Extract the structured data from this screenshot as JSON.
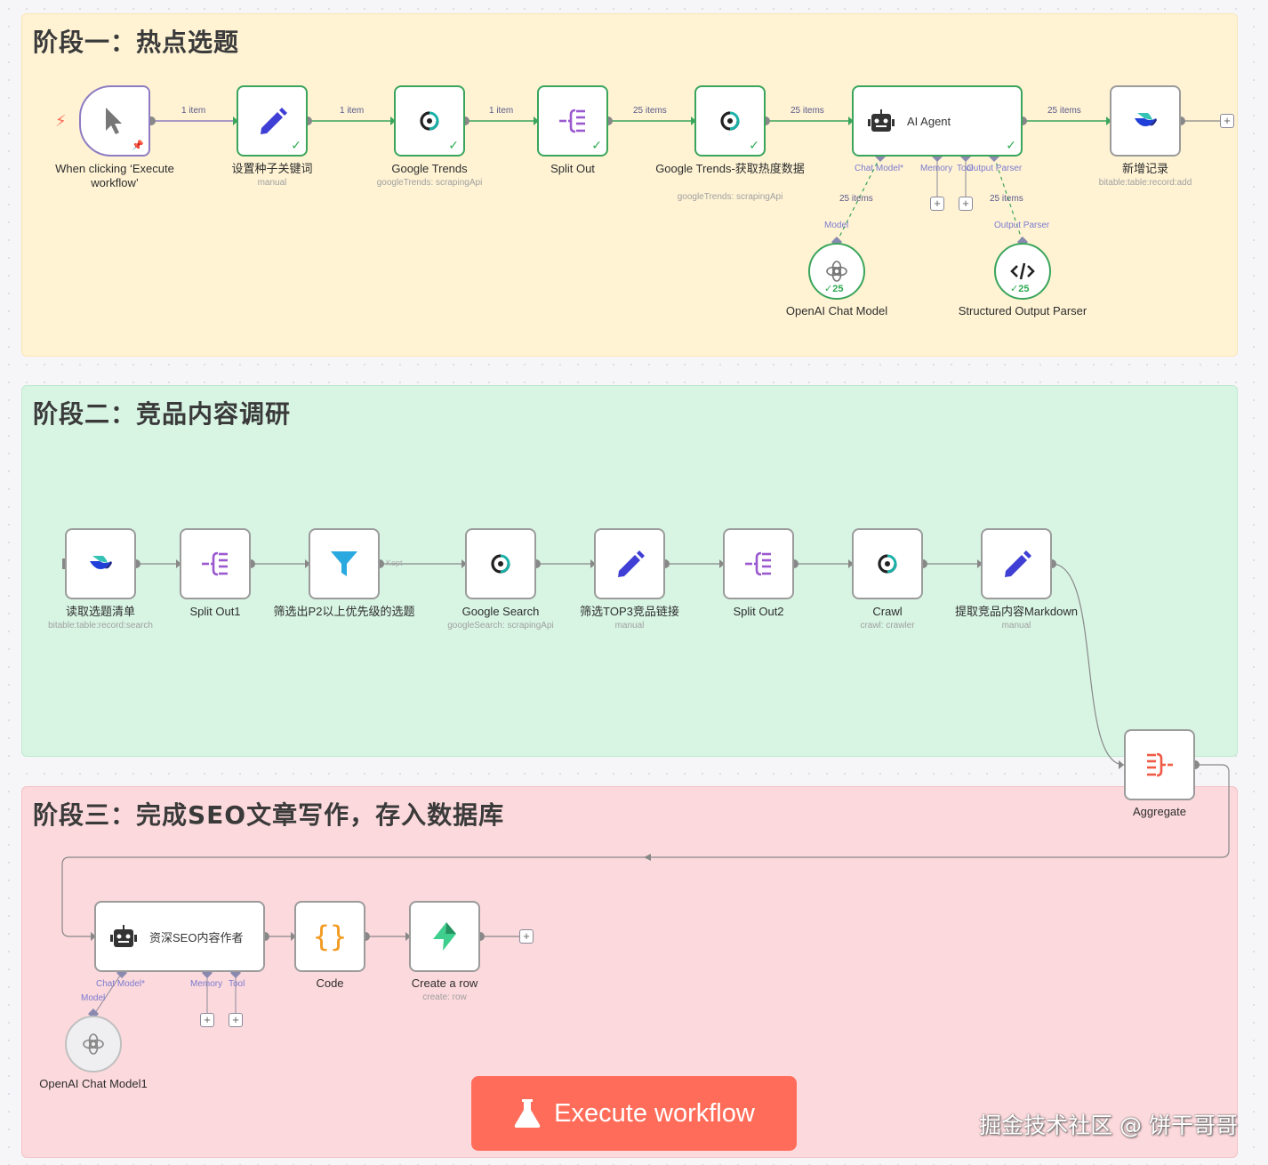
{
  "stages": {
    "s1_title": "阶段一：热点选题",
    "s2_title": "阶段二：竞品内容调研",
    "s3_title": "阶段三：完成SEO文章写作，存入数据库"
  },
  "nodes": {
    "trigger": {
      "label": "When clicking ‘Execute workflow’"
    },
    "seed": {
      "label": "设置种子关键词",
      "sub": "manual"
    },
    "gtrends": {
      "label": "Google Trends",
      "sub": "googleTrends: scrapingApi"
    },
    "split": {
      "label": "Split Out"
    },
    "gtrends2": {
      "label": "Google Trends-获取热度数据",
      "sub": "googleTrends: scrapingApi"
    },
    "agent": {
      "label": "AI Agent"
    },
    "record_add": {
      "label": "新增记录",
      "sub": "bitable:table:record:add"
    },
    "openai": {
      "label": "OpenAI Chat Model",
      "count": "25"
    },
    "parser": {
      "label": "Structured Output Parser",
      "count": "25"
    },
    "read_topics": {
      "label": "读取选题清单",
      "sub": "bitable:table:record:search"
    },
    "split1": {
      "label": "Split Out1"
    },
    "filter": {
      "label": "筛选出P2以上优先级的选题"
    },
    "gsearch": {
      "label": "Google Search",
      "sub": "googleSearch: scrapingApi"
    },
    "top3": {
      "label": "筛选TOP3竞品链接",
      "sub": "manual"
    },
    "split2": {
      "label": "Split Out2"
    },
    "crawl": {
      "label": "Crawl",
      "sub": "crawl: crawler"
    },
    "extract": {
      "label": "提取竞品内容Markdown",
      "sub": "manual"
    },
    "aggregate": {
      "label": "Aggregate"
    },
    "seo_agent": {
      "label": "资深SEO内容作者"
    },
    "code": {
      "label": "Code"
    },
    "create_row": {
      "label": "Create a row",
      "sub": "create: row"
    },
    "openai1": {
      "label": "OpenAI Chat Model1"
    }
  },
  "edges": {
    "e1": "1 item",
    "e2": "1 item",
    "e3": "1 item",
    "e4": "25 items",
    "e5": "25 items",
    "e6": "25 items",
    "model_items": "25 items",
    "parser_items": "25 items",
    "kept": "Kept"
  },
  "ports": {
    "chat_model": "Chat Model*",
    "memory": "Memory",
    "tool": "Tool",
    "output_parser": "Output Parser",
    "model": "Model",
    "output_parser2": "Output Parser"
  },
  "execute_button": "Execute workflow",
  "watermark": "掘金技术社区 @ 饼干哥哥",
  "colors": {
    "accent": "#ff6d5a",
    "success": "#3aa55b",
    "trigger": "#8e7cc3"
  }
}
